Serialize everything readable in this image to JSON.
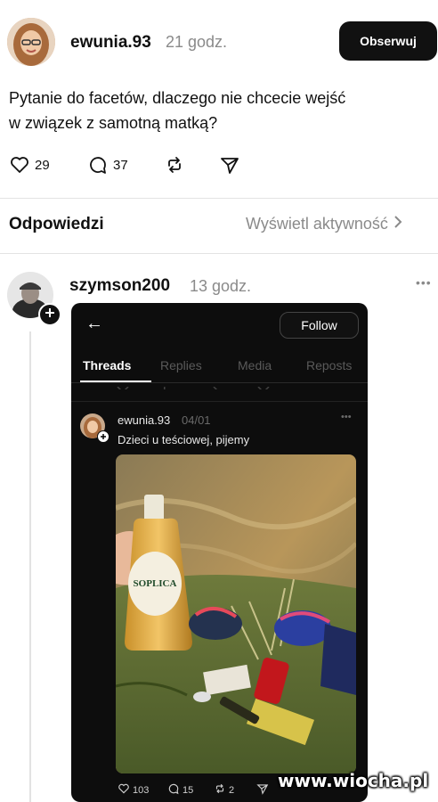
{
  "post": {
    "username": "ewunia.93",
    "time": "21 godz.",
    "follow_label": "Obserwuj",
    "text_line1": "Pytanie do facetów, dlaczego nie chcecie wejść",
    "text_line2": "w związek z samotną matką?",
    "likes": "29",
    "comments": "37"
  },
  "replies_header": {
    "title": "Odpowiedzi",
    "activity_link": "Wyświetl aktywność"
  },
  "reply": {
    "username": "szymson200",
    "time": "13 godz.",
    "more": "•••"
  },
  "embedded": {
    "back": "←",
    "follow_label": "Follow",
    "tabs": [
      "Threads",
      "Replies",
      "Media",
      "Reposts"
    ],
    "username": "ewunia.93",
    "date": "04/01",
    "more": "•••",
    "text": "Dzieci u teściowej, pijemy",
    "likes": "103",
    "comments": "15",
    "reposts": "2",
    "bottle_label": "SOPLICA"
  },
  "watermark": "www.wiocha.pl"
}
